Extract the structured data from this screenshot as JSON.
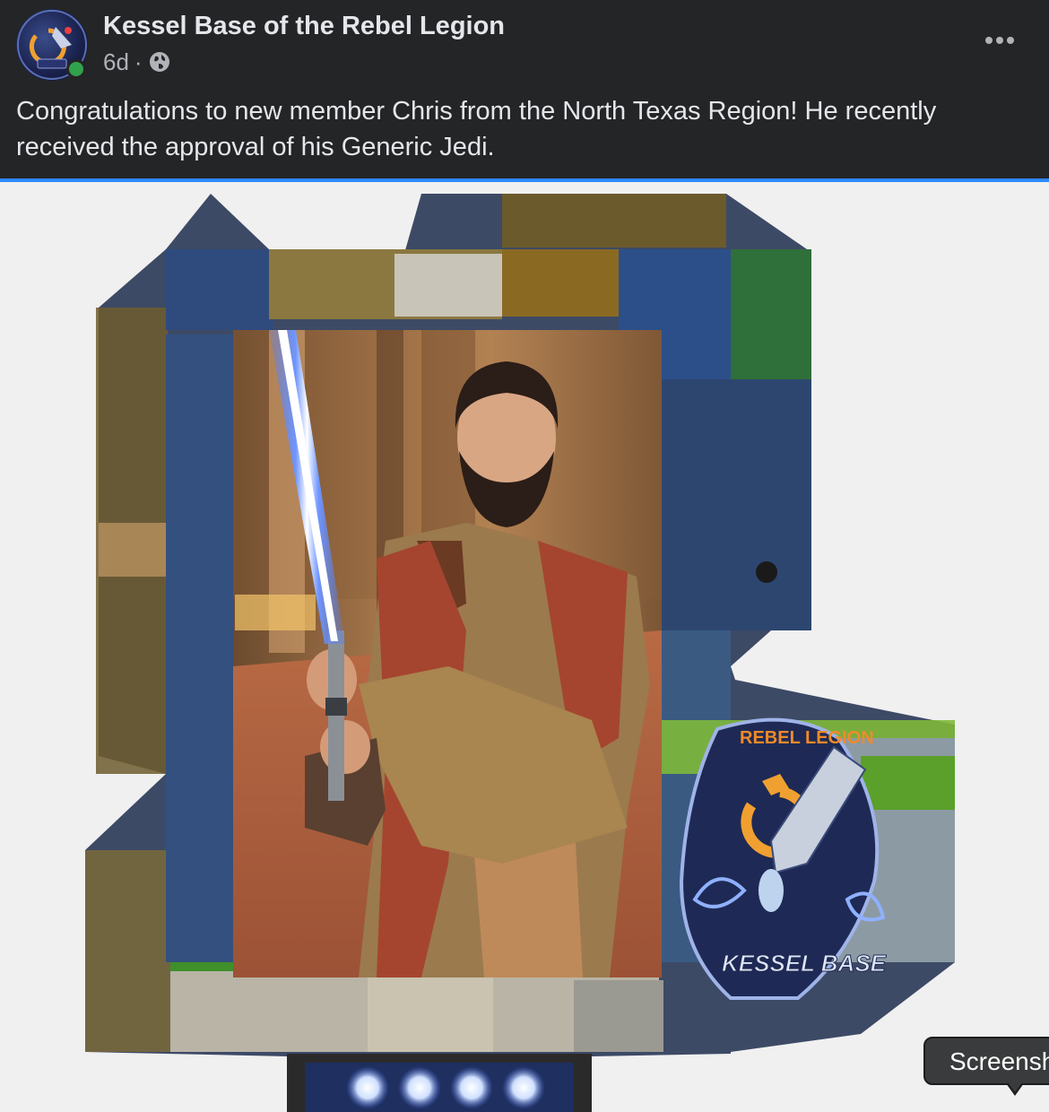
{
  "post": {
    "page_name": "Kessel Base of the Rebel Legion",
    "time": "6d",
    "separator": "·",
    "audience_icon": "globe-icon",
    "more_icon": "more-horizontal-icon",
    "text": "Congratulations to new member Chris from the North Texas Region! He recently received the approval of his Generic Jedi."
  },
  "image": {
    "patch_top_text": "REBEL LEGION",
    "patch_bottom_text": "KESSEL BASE"
  },
  "tooltip": {
    "label": "Screensh"
  },
  "colors": {
    "header_bg": "#242526",
    "text_primary": "#e4e6eb",
    "text_secondary": "#b0b3b8",
    "online": "#31a24c",
    "accent": "#2d88ff",
    "lightsaber": "#4a7bff"
  }
}
